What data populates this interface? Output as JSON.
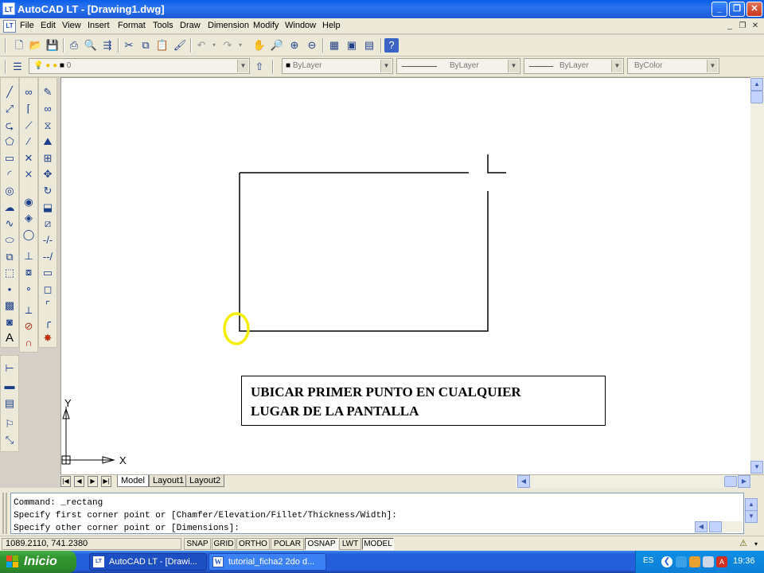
{
  "window": {
    "title": "AutoCAD LT - [Drawing1.dwg]",
    "app_badge": "LT"
  },
  "menubar": {
    "items": [
      "File",
      "Edit",
      "View",
      "Insert",
      "Format",
      "Tools",
      "Draw",
      "Dimension",
      "Modify",
      "Window",
      "Help"
    ]
  },
  "layer_toolbar": {
    "current_layer": "0",
    "color": "ByLayer",
    "linetype": "ByLayer",
    "lineweight": "ByLayer",
    "plot_style": "ByColor"
  },
  "drawing": {
    "ucs_y_label": "Y",
    "ucs_x_label": "X",
    "annotation_line1": "UBICAR PRIMER PUNTO EN CUALQUIER",
    "annotation_line2": "LUGAR DE LA PANTALLA",
    "highlight_color": "#f5ee00",
    "annotation_text_color": "#000000"
  },
  "tabs": [
    {
      "label": "Model",
      "active": true
    },
    {
      "label": "Layout1",
      "active": false
    },
    {
      "label": "Layout2",
      "active": false
    }
  ],
  "command_line": {
    "lines": [
      "Command: _rectang",
      "Specify first corner point or [Chamfer/Elevation/Fillet/Thickness/Width]:",
      "Specify other corner point or [Dimensions]:"
    ]
  },
  "statusbar": {
    "coords": "1089.2110, 741.2380",
    "toggles": [
      {
        "label": "SNAP",
        "on": false
      },
      {
        "label": "GRID",
        "on": false
      },
      {
        "label": "ORTHO",
        "on": false
      },
      {
        "label": "POLAR",
        "on": false
      },
      {
        "label": "OSNAP",
        "on": true
      },
      {
        "label": "LWT",
        "on": false
      },
      {
        "label": "MODEL",
        "on": false
      }
    ]
  },
  "taskbar": {
    "start_label": "Inicio",
    "buttons": [
      {
        "label": "AutoCAD LT - [Drawi...",
        "active": true
      },
      {
        "label": "tutorial_ficha2 2do d...",
        "active": false
      }
    ],
    "language": "ES",
    "clock": "19:36"
  },
  "colors": {
    "titlebar": "#0a5ee8",
    "taskbar": "#245edb",
    "start_button": "#32962f",
    "canvas": "#ffffff"
  }
}
